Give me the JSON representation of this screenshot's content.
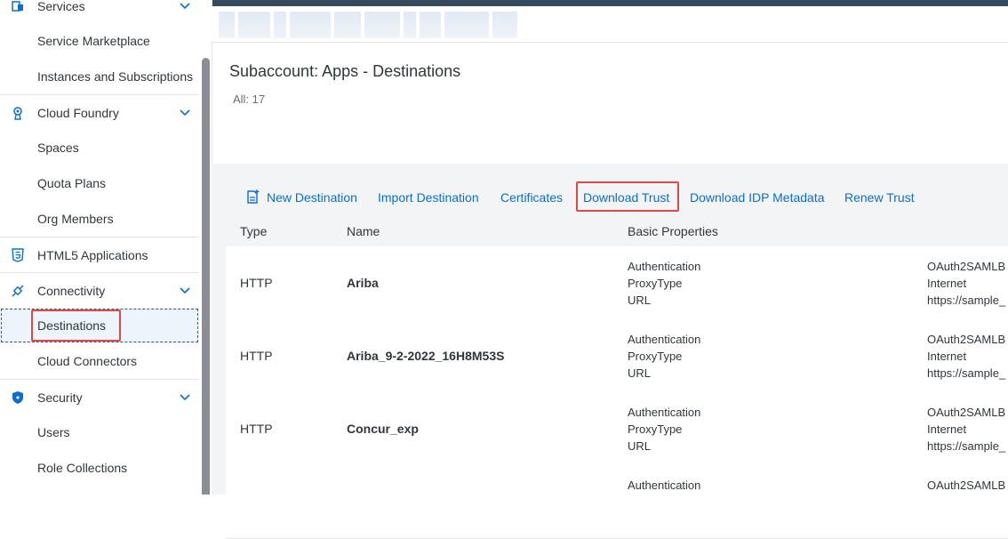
{
  "sidebar": {
    "items": [
      {
        "label": "Services",
        "type": "group"
      },
      {
        "label": "Service Marketplace",
        "type": "sub"
      },
      {
        "label": "Instances and Subscriptions",
        "type": "sub"
      },
      {
        "label": "Cloud Foundry",
        "type": "group"
      },
      {
        "label": "Spaces",
        "type": "sub"
      },
      {
        "label": "Quota Plans",
        "type": "sub"
      },
      {
        "label": "Org Members",
        "type": "sub"
      },
      {
        "label": "HTML5 Applications",
        "type": "group"
      },
      {
        "label": "Connectivity",
        "type": "group"
      },
      {
        "label": "Destinations",
        "type": "sub",
        "selected": true
      },
      {
        "label": "Cloud Connectors",
        "type": "sub"
      },
      {
        "label": "Security",
        "type": "group"
      },
      {
        "label": "Users",
        "type": "sub"
      },
      {
        "label": "Role Collections",
        "type": "sub"
      }
    ]
  },
  "page": {
    "title": "Subaccount: Apps - Destinations",
    "count": "All: 17"
  },
  "toolbar": {
    "new_destination": "New Destination",
    "import_destination": "Import Destination",
    "certificates": "Certificates",
    "download_trust": "Download Trust",
    "download_idp_metadata": "Download IDP Metadata",
    "renew_trust": "Renew Trust"
  },
  "table": {
    "headers": {
      "type": "Type",
      "name": "Name",
      "basic_properties": "Basic Properties"
    },
    "rows": [
      {
        "type": "HTTP",
        "name": "Ariba",
        "p1": "Authentication",
        "p2": "ProxyType",
        "p3": "URL",
        "v1": "OAuth2SAMLB",
        "v2": "Internet",
        "v3": "https://sample_"
      },
      {
        "type": "HTTP",
        "name": "Ariba_9-2-2022_16H8M53S",
        "p1": "Authentication",
        "p2": "ProxyType",
        "p3": "URL",
        "v1": "OAuth2SAMLB",
        "v2": "Internet",
        "v3": "https://sample_"
      },
      {
        "type": "HTTP",
        "name": "Concur_exp",
        "p1": "Authentication",
        "p2": "ProxyType",
        "p3": "URL",
        "v1": "OAuth2SAMLB",
        "v2": "Internet",
        "v3": "https://sample_"
      },
      {
        "type": "",
        "name": "",
        "p1": "Authentication",
        "p2": "",
        "p3": "",
        "v1": "OAuth2SAMLB",
        "v2": "",
        "v3": ""
      }
    ]
  },
  "colors": {
    "accent": "#0a6ed1",
    "shell": "#354a5f",
    "highlight": "#e04848"
  }
}
